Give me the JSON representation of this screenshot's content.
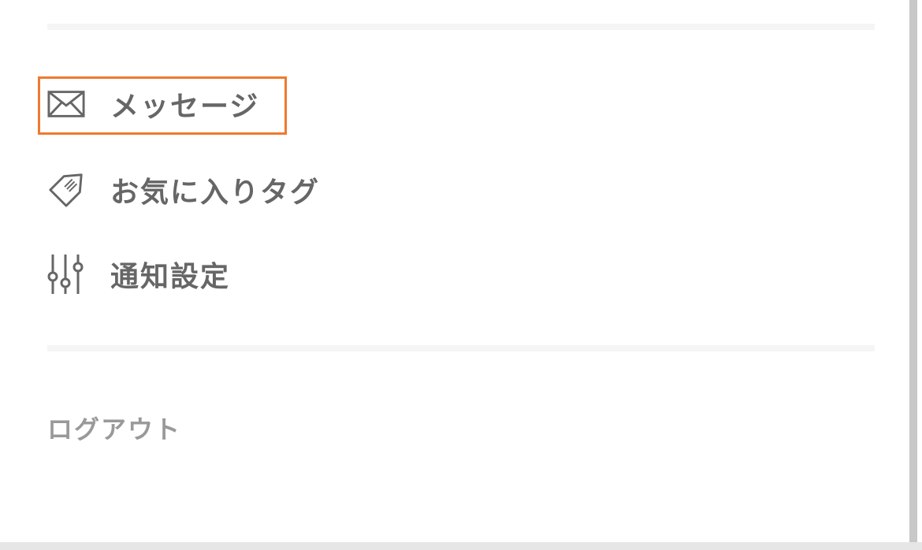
{
  "menu": {
    "items": [
      {
        "label": "メッセージ",
        "icon": "envelope-icon"
      },
      {
        "label": "お気に入りタグ",
        "icon": "tag-icon"
      },
      {
        "label": "通知設定",
        "icon": "sliders-icon"
      }
    ],
    "highlighted_index": 0
  },
  "logout": {
    "label": "ログアウト"
  },
  "colors": {
    "text": "#666666",
    "muted_text": "#999999",
    "highlight_border": "#ee7a30",
    "divider": "#f5f5f5"
  }
}
